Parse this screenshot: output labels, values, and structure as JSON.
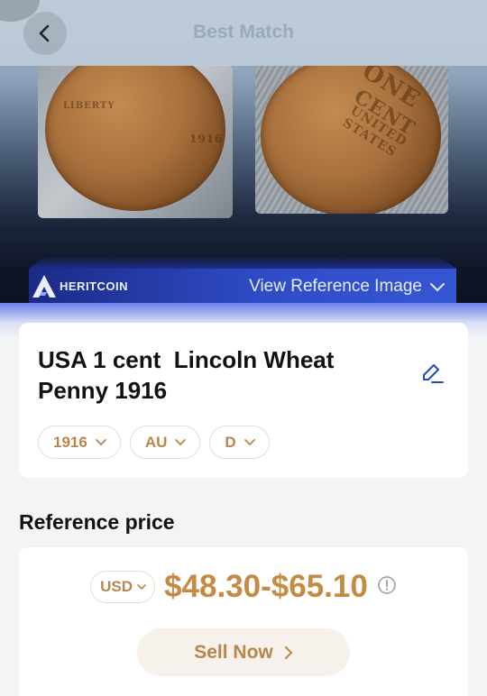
{
  "header": {
    "title": "Best Match"
  },
  "gallery": {
    "obverse": {
      "year_stamp": "1916",
      "motto": "LIBERTY"
    },
    "reverse": {
      "line1": "ONE",
      "line2": "CENT",
      "line3": "UNITED STATES"
    }
  },
  "reference_bar": {
    "brand": "HERITCOIN",
    "link_label": "View Reference Image"
  },
  "coin": {
    "title": "USA 1 cent  Lincoln Wheat Penny 1916",
    "chips": [
      {
        "label": "1916"
      },
      {
        "label": "AU"
      },
      {
        "label": "D"
      }
    ]
  },
  "reference_price": {
    "heading": "Reference price",
    "currency": "USD",
    "range": "$48.30-$65.10",
    "sell_label": "Sell Now"
  },
  "colors": {
    "accent": "#c58b45",
    "brand_blue": "#2f4cc6"
  },
  "icons": [
    "back-arrow-icon",
    "edit-icon",
    "chevron-down-icon",
    "info-icon",
    "chevron-right-icon",
    "heritcoin-logo-icon"
  ]
}
